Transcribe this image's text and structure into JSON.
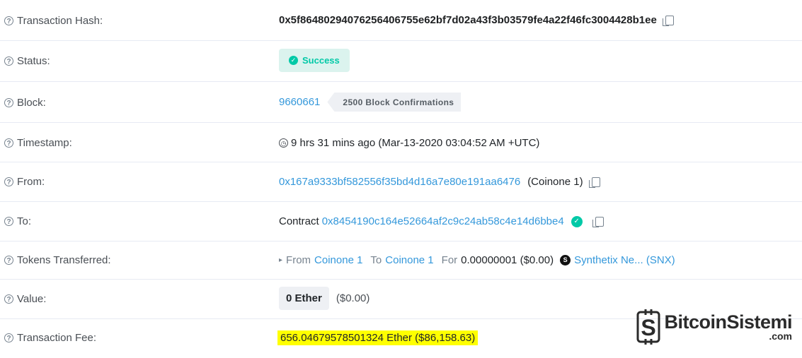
{
  "rows": {
    "hash": {
      "label": "Transaction Hash:",
      "value": "0x5f8648029407625640675 5e62bf7d02a43f3b03579fe4a22f46fc3004428b1ee"
    },
    "status": {
      "label": "Status:",
      "value": "Success"
    },
    "block": {
      "label": "Block:",
      "number": "9660661",
      "confirmations": "2500 Block Confirmations"
    },
    "timestamp": {
      "label": "Timestamp:",
      "value": "9 hrs 31 mins ago (Mar-13-2020 03:04:52 AM +UTC)"
    },
    "from": {
      "label": "From:",
      "address": "0x167a9333bf582556f35bd4d16a7e80e191aa6476",
      "name": "(Coinone 1)"
    },
    "to": {
      "label": "To:",
      "prefix": "Contract",
      "address": "0x8454190c164e52664af2c9c24ab58c4e14d6bbe4"
    },
    "tokens": {
      "label": "Tokens Transferred:",
      "from_word": "From",
      "from_name": "Coinone 1",
      "to_word": "To",
      "to_name": "Coinone 1",
      "for_word": "For",
      "amount": "0.00000001 ($0.00)",
      "token_symbol_icon": "S",
      "token_name": "Synthetix Ne... (SNX)"
    },
    "value": {
      "label": "Value:",
      "amount": "0 Ether",
      "usd": "($0.00)"
    },
    "fee": {
      "label": "Transaction Fee:",
      "value": "656.04679578501324 Ether ($86,158.63)"
    }
  },
  "watermark": {
    "name": "BitcoinSistemi",
    "domain": ".com"
  },
  "icons": {
    "help": "question-circle-icon",
    "copy": "copy-icon",
    "clock": "clock-icon"
  }
}
